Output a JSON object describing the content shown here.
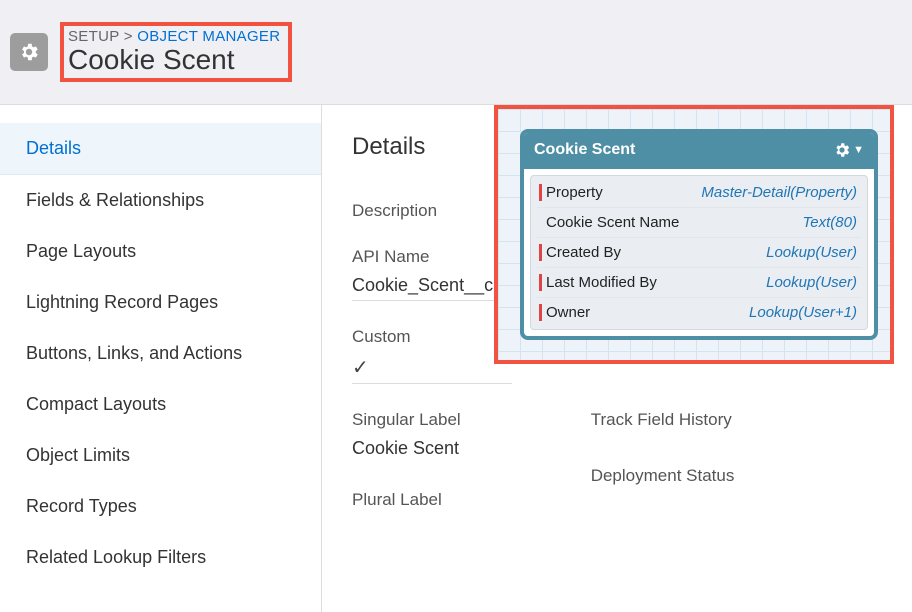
{
  "header": {
    "breadcrumb_setup": "SETUP",
    "breadcrumb_separator": " > ",
    "breadcrumb_link": "OBJECT MANAGER",
    "page_title": "Cookie Scent"
  },
  "sidebar": {
    "items": [
      {
        "label": "Details",
        "active": true
      },
      {
        "label": "Fields & Relationships",
        "active": false
      },
      {
        "label": "Page Layouts",
        "active": false
      },
      {
        "label": "Lightning Record Pages",
        "active": false
      },
      {
        "label": "Buttons, Links, and Actions",
        "active": false
      },
      {
        "label": "Compact Layouts",
        "active": false
      },
      {
        "label": "Object Limits",
        "active": false
      },
      {
        "label": "Record Types",
        "active": false
      },
      {
        "label": "Related Lookup Filters",
        "active": false
      }
    ]
  },
  "main": {
    "title": "Details",
    "description_label": "Description",
    "description_value": "",
    "api_name_label": "API Name",
    "api_name_value": "Cookie_Scent__c",
    "custom_label": "Custom",
    "custom_value_check": "✓",
    "singular_label": "Singular Label",
    "singular_value": "Cookie Scent",
    "plural_label": "Plural Label",
    "track_history_label": "Track Field History",
    "deployment_status_label": "Deployment Status"
  },
  "schema": {
    "title": "Cookie Scent",
    "fields": [
      {
        "name": "Property",
        "type": "Master-Detail(Property)",
        "accent": true
      },
      {
        "name": "Cookie Scent Name",
        "type": "Text(80)",
        "accent": false
      },
      {
        "name": "Created By",
        "type": "Lookup(User)",
        "accent": true
      },
      {
        "name": "Last Modified By",
        "type": "Lookup(User)",
        "accent": true
      },
      {
        "name": "Owner",
        "type": "Lookup(User+1)",
        "accent": true
      }
    ]
  }
}
